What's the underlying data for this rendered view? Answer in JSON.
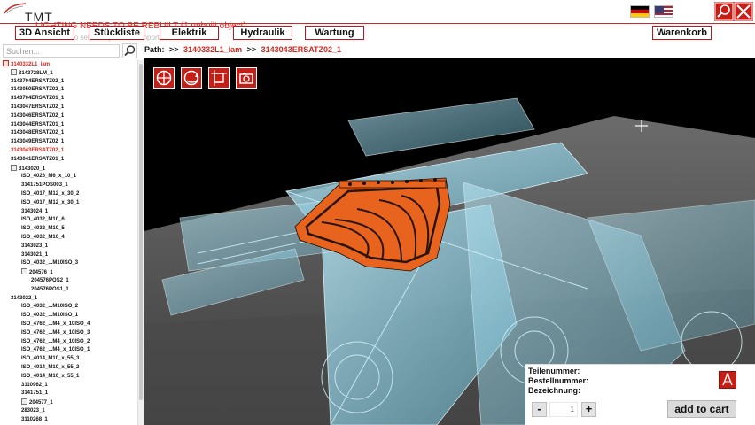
{
  "app": {
    "logo_text": "TMT",
    "warning": "LIGHTING NEEDS TO BE REBUILT (1 unbuilt object)",
    "ghost_text": "Click to select ... press      to support"
  },
  "nav": [
    {
      "label": "3D Ansicht"
    },
    {
      "label": "Stückliste"
    },
    {
      "label": "Elektrik"
    },
    {
      "label": "Hydraulik"
    },
    {
      "label": "Wartung"
    },
    {
      "label": "Warenkorb"
    }
  ],
  "flags": [
    {
      "icon": "flag-germany-icon",
      "colors": [
        "#000000",
        "#dd0000",
        "#ffce00"
      ]
    },
    {
      "icon": "flag-usa-icon",
      "colors": [
        "#b22234",
        "#ffffff",
        "#3c3b6e"
      ]
    }
  ],
  "search": {
    "placeholder": "Suchen...",
    "value": ""
  },
  "tree": [
    {
      "label": "3140332L1_iam",
      "level": 0,
      "icon": "assembly-icon",
      "active": true
    },
    {
      "label": "3143728LM_1",
      "level": 1,
      "icon": "part-icon",
      "active": false
    },
    {
      "label": "3143704ERSATZ02_1",
      "level": 1,
      "icon": "",
      "active": false
    },
    {
      "label": "3143050ERSATZ02_1",
      "level": 1,
      "icon": "",
      "active": false
    },
    {
      "label": "3143704ERSATZ01_1",
      "level": 1,
      "icon": "",
      "active": false
    },
    {
      "label": "3143047ERSATZ02_1",
      "level": 1,
      "icon": "",
      "active": false
    },
    {
      "label": "3143046ERSATZ02_1",
      "level": 1,
      "icon": "",
      "active": false
    },
    {
      "label": "3143044ERSATZ01_1",
      "level": 1,
      "icon": "",
      "active": false
    },
    {
      "label": "3143048ERSATZ02_1",
      "level": 1,
      "icon": "",
      "active": false
    },
    {
      "label": "3143049ERSATZ02_1",
      "level": 1,
      "icon": "",
      "active": false
    },
    {
      "label": "3143043ERSATZ02_1",
      "level": 1,
      "icon": "",
      "active": true
    },
    {
      "label": "3143041ERSATZ01_1",
      "level": 1,
      "icon": "",
      "active": false
    },
    {
      "label": "3143020_1",
      "level": 1,
      "icon": "part-icon",
      "active": false
    },
    {
      "label": "ISO_4026_M6_x_10_1",
      "level": 2,
      "icon": "",
      "active": false
    },
    {
      "label": "3141751POS003_1",
      "level": 2,
      "icon": "",
      "active": false
    },
    {
      "label": "ISO_4017_M12_x_30_2",
      "level": 2,
      "icon": "",
      "active": false
    },
    {
      "label": "ISO_4017_M12_x_30_1",
      "level": 2,
      "icon": "",
      "active": false
    },
    {
      "label": "3143024_1",
      "level": 2,
      "icon": "",
      "active": false
    },
    {
      "label": "ISO_4032_M10_6",
      "level": 2,
      "icon": "",
      "active": false
    },
    {
      "label": "ISO_4032_M10_5",
      "level": 2,
      "icon": "",
      "active": false
    },
    {
      "label": "ISO_4032_M10_4",
      "level": 2,
      "icon": "",
      "active": false
    },
    {
      "label": "3143023_1",
      "level": 2,
      "icon": "",
      "active": false
    },
    {
      "label": "3143021_1",
      "level": 2,
      "icon": "",
      "active": false
    },
    {
      "label": "ISO_4032_...M10ISO_3",
      "level": 2,
      "icon": "",
      "active": false
    },
    {
      "label": "204576_1",
      "level": 2,
      "icon": "part-icon",
      "active": false
    },
    {
      "label": "204576POS2_1",
      "level": 3,
      "icon": "",
      "active": false
    },
    {
      "label": "204576POS1_1",
      "level": 3,
      "icon": "",
      "active": false
    },
    {
      "label": "3143022_1",
      "level": 1,
      "icon": "",
      "active": false
    },
    {
      "label": "ISO_4032_...M10ISO_2",
      "level": 2,
      "icon": "",
      "active": false
    },
    {
      "label": "ISO_4032_...M10ISO_1",
      "level": 2,
      "icon": "",
      "active": false
    },
    {
      "label": "ISO_4762_...M4_x_10ISO_4",
      "level": 2,
      "icon": "",
      "active": false
    },
    {
      "label": "ISO_4762_...M4_x_10ISO_3",
      "level": 2,
      "icon": "",
      "active": false
    },
    {
      "label": "ISO_4762_...M4_x_10ISO_2",
      "level": 2,
      "icon": "",
      "active": false
    },
    {
      "label": "ISO_4762_...M4_x_10ISO_1",
      "level": 2,
      "icon": "",
      "active": false
    },
    {
      "label": "ISO_4014_M10_x_55_3",
      "level": 2,
      "icon": "",
      "active": false
    },
    {
      "label": "ISO_4014_M10_x_55_2",
      "level": 2,
      "icon": "",
      "active": false
    },
    {
      "label": "ISO_4014_M10_x_55_1",
      "level": 2,
      "icon": "",
      "active": false
    },
    {
      "label": "3110962_1",
      "level": 2,
      "icon": "",
      "active": false
    },
    {
      "label": "3141751_1",
      "level": 2,
      "icon": "",
      "active": false
    },
    {
      "label": "204577_1",
      "level": 2,
      "icon": "part-icon",
      "active": false
    },
    {
      "label": "283023_1",
      "level": 2,
      "icon": "",
      "active": false
    },
    {
      "label": "3110268_1",
      "level": 2,
      "icon": "",
      "active": false
    }
  ],
  "path": {
    "label": "Path:",
    "separator": ">>",
    "crumbs": [
      "3140332L1_iam",
      "3143043ERSATZ02_1"
    ]
  },
  "viewport_tools": [
    {
      "icon": "view-front-icon"
    },
    {
      "icon": "rotate-view-icon"
    },
    {
      "icon": "fit-view-icon"
    },
    {
      "icon": "camera-icon"
    }
  ],
  "info": {
    "teilenummer_label": "Teilenummer:",
    "bestellnummer_label": "Bestellnummer:",
    "bezeichnung_label": "Bezeichnung:",
    "minus_label": "-",
    "plus_label": "+",
    "quantity": "1",
    "cart_label": "add to cart",
    "drawing_icon": "technical-drawing-icon"
  },
  "colors": {
    "brand_red": "#c41e17",
    "active_text": "#d7261e",
    "ghost_blue": "#8fd8ec",
    "highlight_orange": "#e8641e"
  }
}
